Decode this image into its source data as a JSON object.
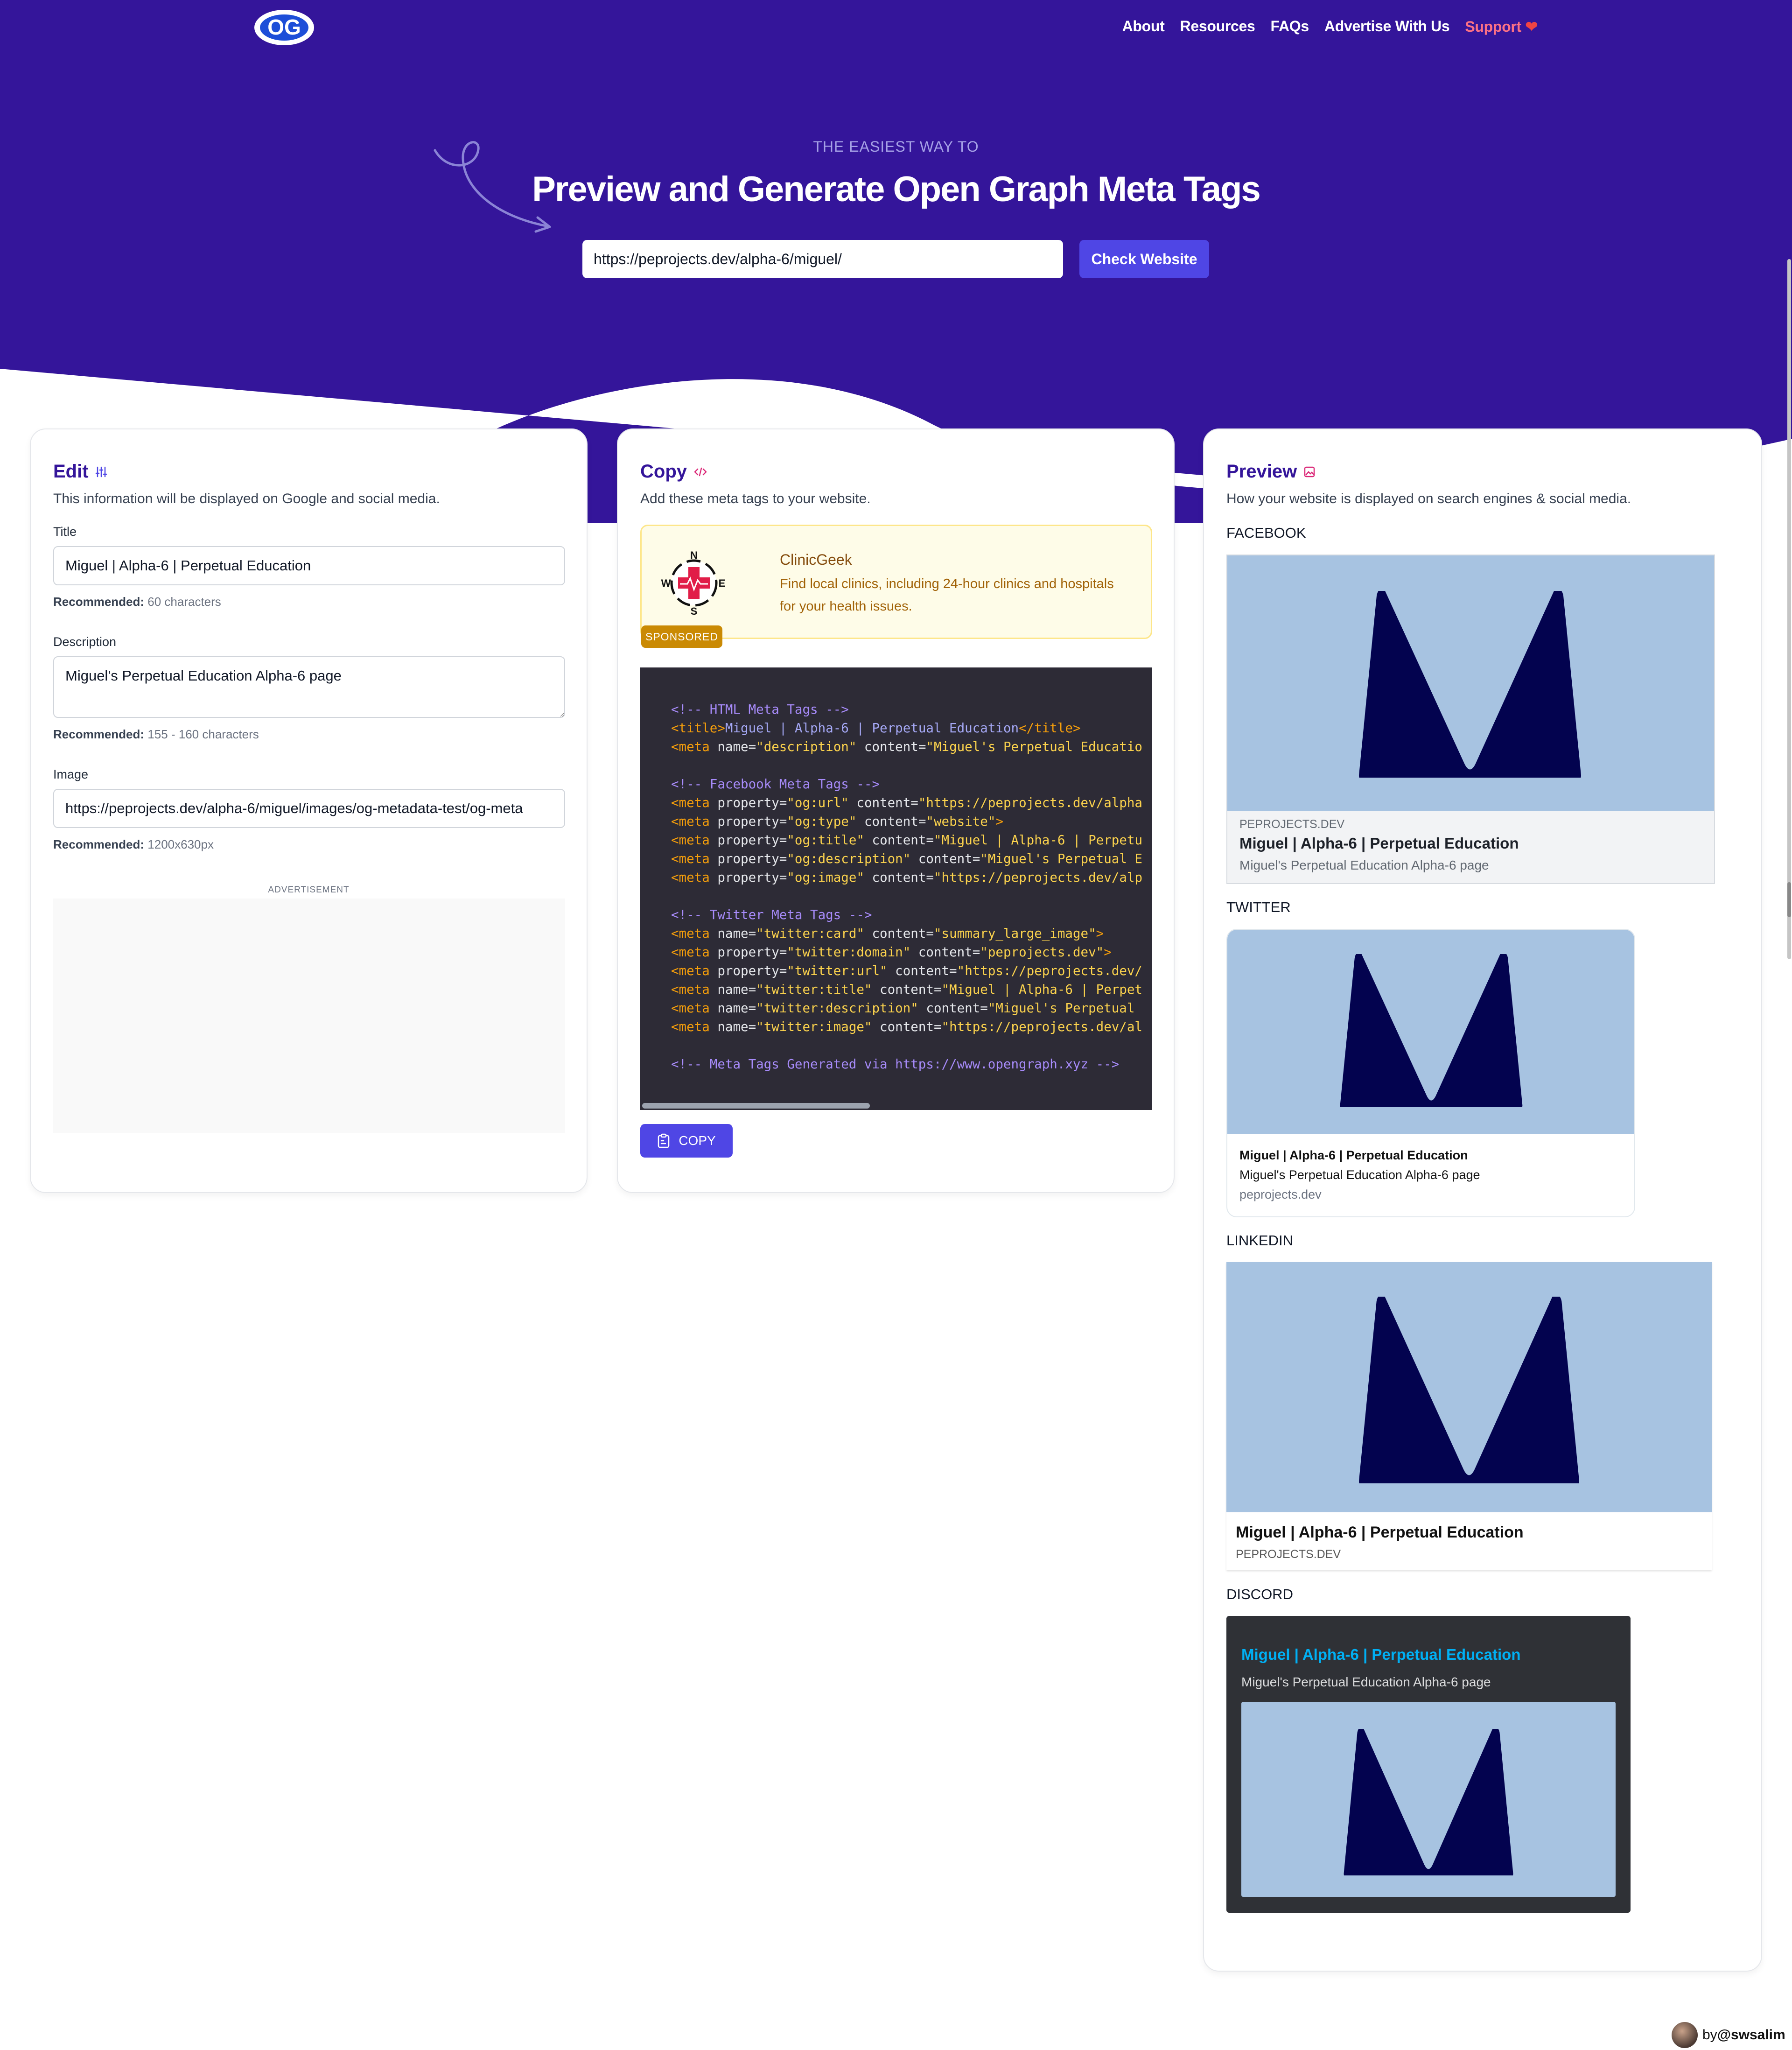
{
  "nav": {
    "logo_text": "OG",
    "items": [
      "About",
      "Resources",
      "FAQs",
      "Advertise With Us"
    ],
    "support_label": "Support",
    "support_icon": "heart-icon"
  },
  "hero": {
    "eyebrow": "THE EASIEST WAY TO",
    "headline": "Preview and Generate Open Graph Meta Tags",
    "url_value": "https://peprojects.dev/alpha-6/miguel/",
    "check_button": "Check Website"
  },
  "edit": {
    "title": "Edit",
    "icon": "sliders-icon",
    "subtitle": "This information will be displayed on Google and social media.",
    "title_label": "Title",
    "title_value": "Miguel | Alpha-6 | Perpetual Education",
    "title_rec_label": "Recommended:",
    "title_rec_value": "60 characters",
    "description_label": "Description",
    "description_value": "Miguel's Perpetual Education Alpha-6 page",
    "description_rec_label": "Recommended:",
    "description_rec_value": "155 - 160 characters",
    "image_label": "Image",
    "image_value": "https://peprojects.dev/alpha-6/miguel/images/og-metadata-test/og-meta",
    "image_rec_label": "Recommended:",
    "image_rec_value": "1200x630px",
    "ad_label": "ADVERTISEMENT"
  },
  "copy": {
    "title": "Copy",
    "icon": "code-icon",
    "subtitle": "Add these meta tags to your website.",
    "sponsor_name": "ClinicGeek",
    "sponsor_desc": "Find local clinics, including 24-hour clinics and hospitals for your health issues.",
    "sponsor_badge": "SPONSORED",
    "sponsor_compass": [
      "N",
      "E",
      "S",
      "W"
    ],
    "copy_button": "COPY",
    "code": {
      "html_comment": "<!-- HTML Meta Tags -->",
      "title_tag": "Miguel | Alpha-6 | Perpetual Education",
      "meta_description": "Miguel's Perpetual Educatio",
      "fb_comment": "<!-- Facebook Meta Tags -->",
      "og_url": "https://peprojects.dev/alpha",
      "og_type": "website",
      "og_title": "Miguel | Alpha-6 | Perpetu",
      "og_description": "Miguel's Perpetual E",
      "og_image": "https://peprojects.dev/alp",
      "tw_comment": "<!-- Twitter Meta Tags -->",
      "twitter_card": "summary_large_image",
      "twitter_domain": "peprojects.dev",
      "twitter_url": "https://peprojects.dev/",
      "twitter_title": "Miguel | Alpha-6 | Perpet",
      "twitter_description": "Miguel's Perpetual ",
      "twitter_image": "https://peprojects.dev/al",
      "footer_comment": "<!-- Meta Tags Generated via https://www.opengraph.xyz -->"
    }
  },
  "preview": {
    "title": "Preview",
    "icon": "image-icon",
    "subtitle": "How your website is displayed on search engines & social media.",
    "facebook": {
      "label": "FACEBOOK",
      "domain": "PEPROJECTS.DEV",
      "title": "Miguel | Alpha-6 | Perpetual Education",
      "description": "Miguel's Perpetual Education Alpha-6 page"
    },
    "twitter": {
      "label": "TWITTER",
      "title": "Miguel | Alpha-6 | Perpetual Education",
      "description": "Miguel's Perpetual Education Alpha-6 page",
      "domain": "peprojects.dev"
    },
    "linkedin": {
      "label": "LINKEDIN",
      "title": "Miguel | Alpha-6 | Perpetual Education",
      "domain": "PEPROJECTS.DEV"
    },
    "discord": {
      "label": "DISCORD",
      "title": "Miguel | Alpha-6 | Perpetual Education",
      "description": "Miguel's Perpetual Education Alpha-6 page"
    }
  },
  "footer": {
    "by_prefix": "by",
    "handle": "@swsalim"
  },
  "colors": {
    "hero_bg": "#34159a",
    "accent": "#4f46e5",
    "support": "#fb7185",
    "image_bg": "#a7c3e1",
    "image_logo": "#03034f"
  }
}
